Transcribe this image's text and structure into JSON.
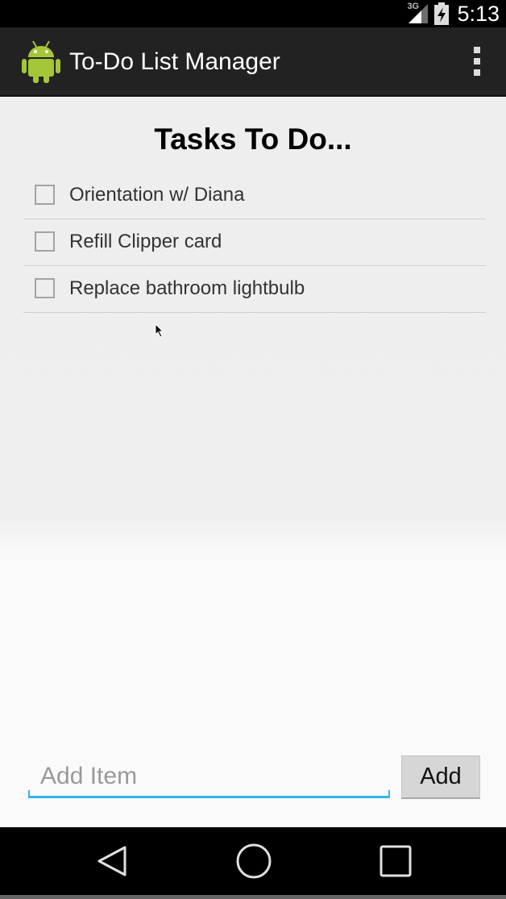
{
  "status_bar": {
    "network": "3G",
    "time": "5:13",
    "icons": [
      "signal-icon",
      "battery-charging-icon"
    ]
  },
  "action_bar": {
    "title": "To-Do List Manager",
    "app_icon": "android-robot-icon",
    "overflow_icon": "overflow-menu-icon"
  },
  "main": {
    "heading": "Tasks To Do...",
    "tasks": [
      {
        "label": "Orientation w/ Diana",
        "checked": false
      },
      {
        "label": "Refill Clipper card",
        "checked": false
      },
      {
        "label": "Replace bathroom lightbulb",
        "checked": false
      }
    ],
    "add_item": {
      "placeholder": "Add Item",
      "value": ""
    },
    "add_button": "Add"
  },
  "nav_bar": {
    "icons": [
      "back-icon",
      "home-icon",
      "recent-apps-icon"
    ]
  },
  "colors": {
    "accent": "#33b5e5",
    "action_bar": "#222222",
    "android_green": "#a4c639"
  }
}
